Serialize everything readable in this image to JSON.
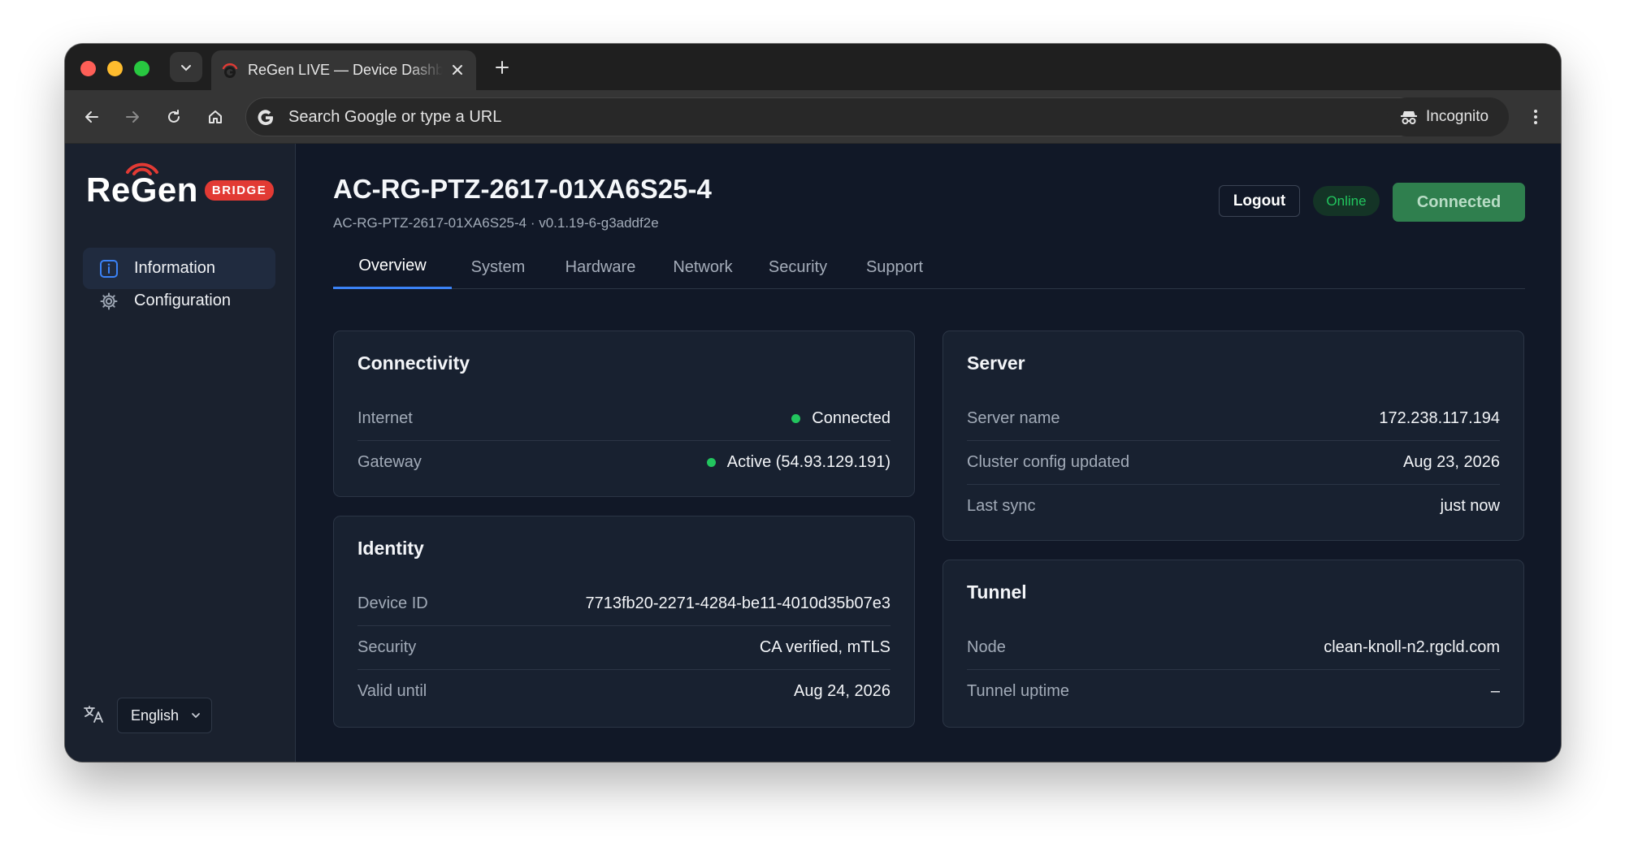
{
  "browser": {
    "tab_title": "ReGen LIVE — Device Dashboard",
    "omnibox_placeholder": "Search Google or type a URL",
    "incognito_label": "Incognito"
  },
  "sidebar": {
    "logo_text": "ReGen",
    "logo_badge": "BRIDGE",
    "items": [
      {
        "label": "Information",
        "icon": "info-icon",
        "active": true
      },
      {
        "label": "Configuration",
        "icon": "gear-icon",
        "active": false
      }
    ],
    "language": "English"
  },
  "header": {
    "title": "AC-RG-PTZ-2617-01XA6S25-4",
    "subtitle": "AC-RG-PTZ-2617-01XA6S25-4 · v0.1.19-6-g3addf2e",
    "logout_label": "Logout",
    "status_badge": "Online",
    "connected_label": "Connected"
  },
  "tabs": [
    "Overview",
    "System",
    "Hardware",
    "Network",
    "Security",
    "Support"
  ],
  "cards": {
    "connectivity": {
      "title": "Connectivity",
      "rows": [
        {
          "label": "Internet",
          "value": "Connected"
        },
        {
          "label": "Gateway",
          "value": "Active (54.93.129.191)"
        }
      ]
    },
    "identity": {
      "title": "Identity",
      "rows": [
        {
          "label": "Device ID",
          "value": "7713fb20-2271-4284-be11-4010d35b07e3"
        },
        {
          "label": "Security",
          "value": "CA verified, mTLS"
        },
        {
          "label": "Valid until",
          "value": "Aug 24, 2026"
        }
      ]
    },
    "server": {
      "title": "Server",
      "rows": [
        {
          "label": "Server name",
          "value": "172.238.117.194"
        },
        {
          "label": "Cluster config updated",
          "value": "Aug 23, 2026"
        },
        {
          "label": "Last sync",
          "value": "just now"
        }
      ]
    },
    "tunnel": {
      "title": "Tunnel",
      "rows": [
        {
          "label": "Node",
          "value": "clean-knoll-n2.rgcld.com"
        },
        {
          "label": "Tunnel uptime",
          "value": "–"
        }
      ]
    }
  },
  "colors": {
    "accent": "#3b82f6",
    "success": "#22c55e",
    "brand_red": "#e23a34",
    "background": "#111827"
  }
}
